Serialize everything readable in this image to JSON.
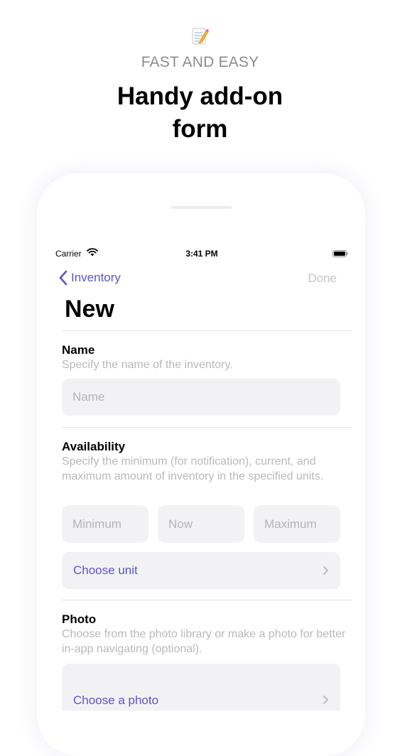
{
  "promo": {
    "eyebrow": "FAST AND EASY",
    "headline_line1": "Handy add-on",
    "headline_line2": "form"
  },
  "status_bar": {
    "carrier": "Carrier",
    "time": "3:41 PM"
  },
  "nav": {
    "back_label": "Inventory",
    "done_label": "Done"
  },
  "page": {
    "title": "New"
  },
  "name_section": {
    "title": "Name",
    "description": "Specify the name of the inventory.",
    "placeholder": "Name"
  },
  "availability_section": {
    "title": "Availability",
    "description": "Specify the minimum (for notification), current, and maximum amount of inventory in the specified units.",
    "min_placeholder": "Minimum",
    "now_placeholder": "Now",
    "max_placeholder": "Maximum",
    "unit_label": "Choose unit"
  },
  "photo_section": {
    "title": "Photo",
    "description": "Choose from the photo library or make a photo for better in-app navigating (optional).",
    "choose_label": "Choose a photo"
  },
  "colors": {
    "accent": "#5a55c9",
    "field_bg": "#f2f2f5",
    "muted_text": "#b9b9be"
  }
}
